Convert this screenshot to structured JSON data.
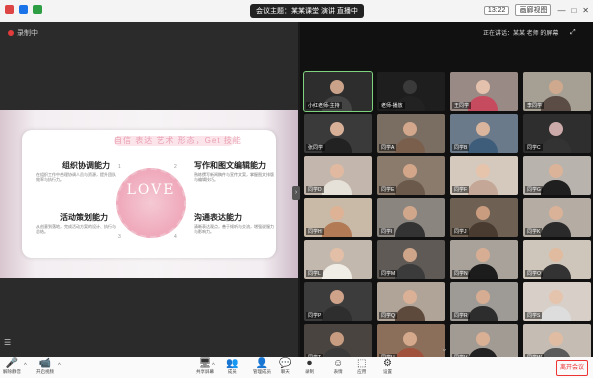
{
  "titlebar": {
    "title": "会议主题：某某课堂 演讲 直播中",
    "view_label": "视图",
    "time": "13:22",
    "layout_label": "画廊视图",
    "icon_colors": [
      "#d44",
      "#1a73e8",
      "#2e9e45"
    ]
  },
  "stage": {
    "recording_label": "录制中",
    "menu_icon": "☰",
    "side_arrow": "›"
  },
  "slide": {
    "title": "自信 表达 艺术 形态，Get 技能",
    "center_word": "LOVE",
    "nums": [
      "1",
      "2",
      "3",
      "4"
    ],
    "sections": [
      {
        "title": "组织协调能力",
        "body": "在组织工作中合理协调人员与资源，提升团队效率与执行力。"
      },
      {
        "title": "写作和图文编辑能力",
        "body": "熟练撰写新闻稿件与宣传文案，掌握图文排版与编辑技巧。"
      },
      {
        "title": "活动策划能力",
        "body": "从创意到落地，完成活动方案的设计、执行与总结。"
      },
      {
        "title": "沟通表达能力",
        "body": "清晰表达观点，善于倾听与交流，增强说服力与影响力。"
      }
    ]
  },
  "gallery": {
    "header": "正在讲话：某某 老师 的屏幕",
    "min_icon": "⤢",
    "down_arrow": "⌄",
    "tiles": [
      {
        "name": "小红老师-主持",
        "bg": "#2d2d2d",
        "skin": "#caa28a",
        "shirt": "#444",
        "active": true
      },
      {
        "name": "老师-播放",
        "bg": "#1e1e1e",
        "skin": "#3a3a3a",
        "shirt": "#222",
        "active": false
      },
      {
        "name": "王同学",
        "bg": "#9a8a86",
        "skin": "#e4c1ad",
        "shirt": "#c64b5f",
        "active": false
      },
      {
        "name": "李同学",
        "bg": "#a6a094",
        "skin": "#cfa98e",
        "shirt": "#5b4d45",
        "active": false
      },
      {
        "name": "张同学",
        "bg": "#3a3a3a",
        "skin": "#d8b098",
        "shirt": "#222",
        "active": false
      },
      {
        "name": "同学A",
        "bg": "#7a6e62",
        "skin": "#d2a78b",
        "shirt": "#7a5f4c",
        "active": false
      },
      {
        "name": "同学B",
        "bg": "#6a7a8a",
        "skin": "#d8b59c",
        "shirt": "#3d5d7a",
        "active": false
      },
      {
        "name": "同学C",
        "bg": "#2e2e2e",
        "skin": "#caa",
        "shirt": "#333",
        "active": false
      },
      {
        "name": "同学D",
        "bg": "#c3b7ad",
        "skin": "#e0b9a0",
        "shirt": "#e5e0d8",
        "active": false
      },
      {
        "name": "同学E",
        "bg": "#8b7b6d",
        "skin": "#d3a68a",
        "shirt": "#6b5a4c",
        "active": false
      },
      {
        "name": "同学F",
        "bg": "#d5c9bd",
        "skin": "#e6c3ab",
        "shirt": "#c4a797",
        "active": false
      },
      {
        "name": "同学G",
        "bg": "#b8b3ad",
        "skin": "#dbb399",
        "shirt": "#1f1f1f",
        "active": false
      },
      {
        "name": "同学H",
        "bg": "#c9b9a7",
        "skin": "#deb295",
        "shirt": "#b27a55",
        "active": false
      },
      {
        "name": "同学I",
        "bg": "#8b8580",
        "skin": "#d1a78c",
        "shirt": "#333",
        "active": false
      },
      {
        "name": "同学J",
        "bg": "#6e6153",
        "skin": "#c99c7f",
        "shirt": "#4a3b31",
        "active": false
      },
      {
        "name": "同学K",
        "bg": "#b5aca3",
        "skin": "#d9b298",
        "shirt": "#2a2a2a",
        "active": false
      },
      {
        "name": "同学L",
        "bg": "#c2b8ad",
        "skin": "#e2bfa6",
        "shirt": "#f0ece6",
        "active": false
      },
      {
        "name": "同学M",
        "bg": "#5f5a55",
        "skin": "#cfa58a",
        "shirt": "#3b3b3b",
        "active": false
      },
      {
        "name": "同学N",
        "bg": "#a9a29a",
        "skin": "#d7ae93",
        "shirt": "#1c1c1c",
        "active": false
      },
      {
        "name": "同学O",
        "bg": "#cfc6bb",
        "skin": "#e1bb9f",
        "shirt": "#333",
        "active": false
      },
      {
        "name": "同学P",
        "bg": "#3c3c3c",
        "skin": "#cfa28a",
        "shirt": "#2e2e2e",
        "active": false
      },
      {
        "name": "同学Q",
        "bg": "#b0a397",
        "skin": "#dab196",
        "shirt": "#5e4a3d",
        "active": false
      },
      {
        "name": "同学R",
        "bg": "#9e9a96",
        "skin": "#d6ad92",
        "shirt": "#2d2d2d",
        "active": false
      },
      {
        "name": "同学S",
        "bg": "#d8d0c8",
        "skin": "#e5c4ad",
        "shirt": "#ddd",
        "active": false
      },
      {
        "name": "同学T",
        "bg": "#4a4440",
        "skin": "#c79c80",
        "shirt": "#3a3a3a",
        "active": false
      },
      {
        "name": "同学U",
        "bg": "#8c6f5b",
        "skin": "#d5a98c",
        "shirt": "#a0523d",
        "active": false
      },
      {
        "name": "同学V",
        "bg": "#a29b94",
        "skin": "#dab094",
        "shirt": "#222",
        "active": false
      },
      {
        "name": "同学W",
        "bg": "#c5bdb4",
        "skin": "#e0bca2",
        "shirt": "#5b5b5b",
        "active": false
      }
    ]
  },
  "toolbar": {
    "items": [
      {
        "key": "mute",
        "icon": "🎤",
        "label": "解除静音"
      },
      {
        "key": "video",
        "icon": "📹",
        "label": "开启视频"
      },
      {
        "key": "share",
        "icon": "🖥",
        "label": "共享屏幕"
      },
      {
        "key": "members",
        "icon": "👥",
        "label": "成员"
      },
      {
        "key": "manage",
        "icon": "👤",
        "label": "管理成员"
      },
      {
        "key": "chat",
        "icon": "💬",
        "label": "聊天"
      },
      {
        "key": "record",
        "icon": "⏺",
        "label": "录制"
      },
      {
        "key": "reactions",
        "icon": "☺",
        "label": "表情"
      },
      {
        "key": "apps",
        "icon": "⬚",
        "label": "应用"
      },
      {
        "key": "settings",
        "icon": "⚙",
        "label": "设置"
      }
    ],
    "leave_label": "离开会议"
  }
}
